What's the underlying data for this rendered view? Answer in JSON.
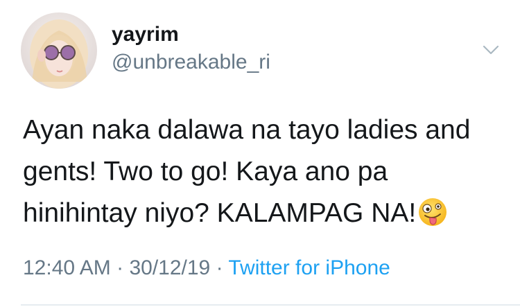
{
  "tweet": {
    "display_name": "yayrim",
    "handle": "@unbreakable_ri",
    "text_lines": [
      "Ayan naka dalawa na tayo ladies and",
      "gents! Two to go! Kaya ano pa",
      "hinihintay niyo? KALAMPAG NA!"
    ],
    "emoji": "zany-face",
    "time": "12:40 AM",
    "separator": "·",
    "date": "30/12/19",
    "source": "Twitter for iPhone"
  },
  "icons": {
    "menu": "chevron-down-icon",
    "avatar": "profile-photo"
  },
  "colors": {
    "text": "#14171a",
    "secondary": "#657786",
    "link": "#1da1f2",
    "divider": "#e6ecf0"
  }
}
